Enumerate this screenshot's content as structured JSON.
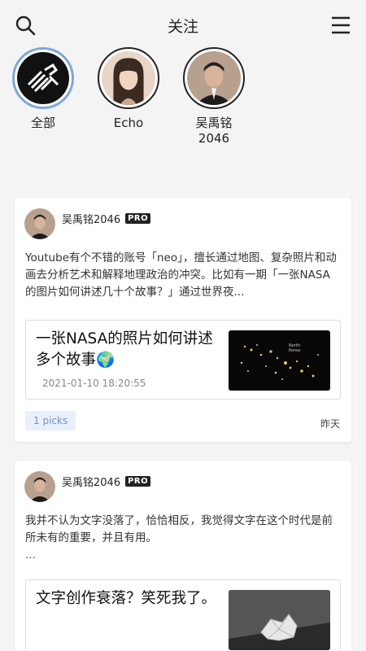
{
  "header": {
    "title": "关注",
    "search_icon": "search-icon",
    "menu_icon": "hamburger-menu-icon"
  },
  "stories": [
    {
      "name": "全部",
      "active": true
    },
    {
      "name": "Echo",
      "active": false
    },
    {
      "name": "吴禹铭\n2046",
      "active": false
    }
  ],
  "posts": [
    {
      "author": "吴禹铭2046",
      "badge": "PRO",
      "text": "Youtube有个不错的账号「neo」，擅长通过地图、复杂照片和动画去分析艺术和解释地理政治的冲突。比如有一期「一张NASA的图片如何讲述几十个故事？」通过世界夜...",
      "link_title": "一张NASA的照片如何讲述多个故事🌍",
      "link_date": "2021-01-10 18:20:55",
      "picks": "1 picks",
      "time": "昨天"
    },
    {
      "author": "吴禹铭2046",
      "badge": "PRO",
      "text": "我并不认为文字没落了，恰恰相反，我觉得文字在这个时代是前所未有的重要，并且有用。",
      "ellipsis": "...",
      "link_title": "文字创作衰落？笑死我了。"
    }
  ],
  "colors": {
    "accent_ring": "#7da7d9",
    "picks_bg": "#e9f0fb",
    "picks_text": "#6e93c9",
    "page_bg": "#f4f4f4"
  }
}
